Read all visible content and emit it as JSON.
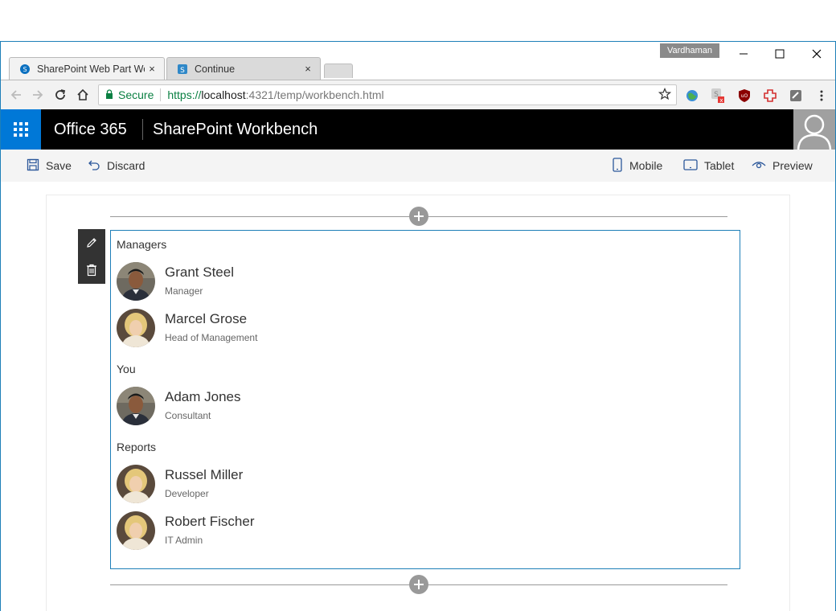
{
  "window": {
    "user_badge": "Vardhaman",
    "tabs": [
      {
        "label": "SharePoint Web Part Wor",
        "close": "×"
      },
      {
        "label": "Continue",
        "close": "×"
      }
    ]
  },
  "address_bar": {
    "secure_label": "Secure",
    "url_protocol": "https://",
    "url_host": "localhost",
    "url_path": ":4321/temp/workbench.html"
  },
  "suite_bar": {
    "brand": "Office 365",
    "title": "SharePoint Workbench"
  },
  "command_bar": {
    "save": "Save",
    "discard": "Discard",
    "mobile": "Mobile",
    "tablet": "Tablet",
    "preview": "Preview"
  },
  "web_part": {
    "sections": [
      {
        "title": "Managers",
        "people": [
          {
            "name": "Grant Steel",
            "role": "Manager",
            "photo": "man"
          },
          {
            "name": "Marcel Grose",
            "role": "Head of Management",
            "photo": "woman"
          }
        ]
      },
      {
        "title": "You",
        "people": [
          {
            "name": "Adam Jones",
            "role": "Consultant",
            "photo": "man"
          }
        ]
      },
      {
        "title": "Reports",
        "people": [
          {
            "name": "Russel Miller",
            "role": "Developer",
            "photo": "woman"
          },
          {
            "name": "Robert Fischer",
            "role": "IT Admin",
            "photo": "woman"
          }
        ]
      }
    ]
  },
  "colors": {
    "suite_bar": "#000000",
    "waffle": "#0078d7",
    "accent_border": "#1e7fb8"
  }
}
